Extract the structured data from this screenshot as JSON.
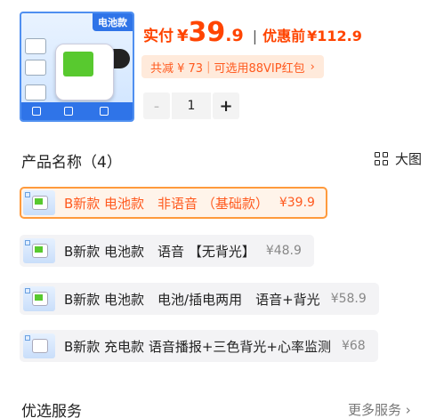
{
  "product": {
    "image_badge": "电池款",
    "price_label": "实付",
    "currency": "¥",
    "price_integer": "39",
    "price_decimal": ".9",
    "separator": "|",
    "original_label": "优惠前",
    "original_price": "¥112.9"
  },
  "promo": {
    "saving": "共减 ¥ 73",
    "separator": "|",
    "offer": "可选用88VIP红包",
    "chevron": "›"
  },
  "quantity": {
    "minus": "-",
    "value": "1",
    "plus": "+"
  },
  "options_section": {
    "title": "产品名称（4）",
    "view_label": "大图"
  },
  "options": [
    {
      "name": "B新款 电池款　非语音 （基础款）",
      "price": "¥39.9",
      "selected": true
    },
    {
      "name": "B新款 电池款　语音 【无背光】",
      "price": "¥48.9",
      "selected": false
    },
    {
      "name": "B新款 电池款　电池/插电两用　语音+背光",
      "price": "¥58.9",
      "selected": false
    },
    {
      "name": "B新款 充电款 语音播报+三色背光+心率监测",
      "price": "¥68",
      "selected": false
    }
  ],
  "services": {
    "title": "优选服务",
    "more": "更多服务 ›"
  },
  "colors": {
    "accent": "#ff4400",
    "promo_bg": "#ffeadb",
    "selected_border": "#ff9a3c",
    "image_blue": "#2f74e8"
  }
}
